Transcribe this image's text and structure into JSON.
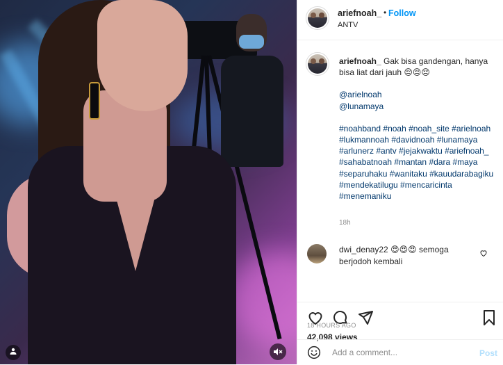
{
  "post": {
    "username": "ariefnoah_",
    "follow_label": "Follow",
    "separator": "•",
    "location": "ANTV"
  },
  "caption": {
    "username": "ariefnoah_",
    "text": "Gak bisa gandengan, hanya bisa liat dari jauh 😔😔😔",
    "mentions": [
      "@arielnoah",
      "@lunamaya"
    ],
    "hashtags": "#noahband #noah #noah_site #arielnoah #lukmannoah #davidnoah #lunamaya #arlunerz #antv #jejakwaktu #ariefnoah_ #sahabatnoah #mantan #dara #maya #separuhaku #wanitaku #kauudarabagiku #mendekatilugu #mencaricinta #menemaniku",
    "time": "18h"
  },
  "comment": {
    "username": "dwi_denay22",
    "text": "😍😍😍 semoga berjodoh kembali"
  },
  "stats": {
    "views": "42,098 views",
    "ago": "18 HOURS AGO"
  },
  "comment_box": {
    "placeholder": "Add a comment...",
    "post_label": "Post"
  },
  "colors": {
    "accent": "#0095f6",
    "link": "#00376b",
    "muted": "#8e8e8e",
    "post_disabled": "#b2dffc"
  }
}
